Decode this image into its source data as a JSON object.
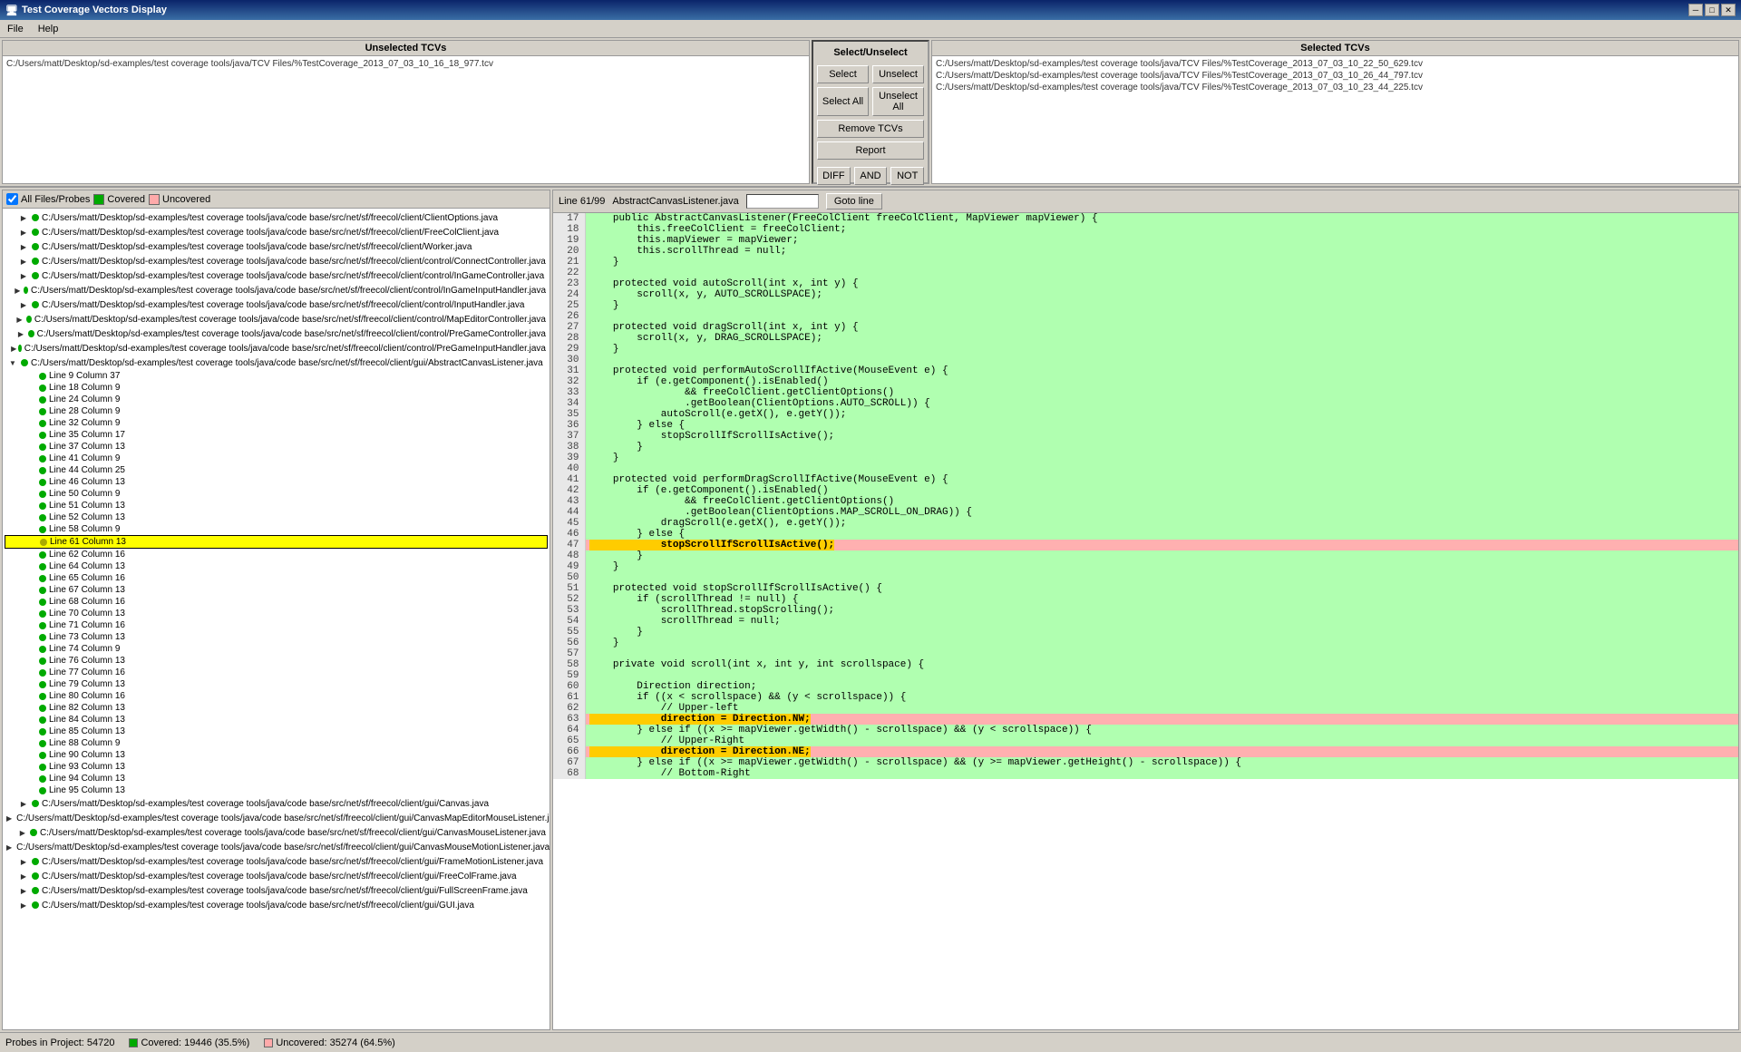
{
  "window": {
    "title": "Test Coverage Vectors Display",
    "menu": [
      "File",
      "Help"
    ]
  },
  "unselected_panel": {
    "header": "Unselected TCVs",
    "files": [
      "C:/Users/matt/Desktop/sd-examples/test coverage tools/java/TCV Files/%TestCoverage_2013_07_03_10_16_18_977.tcv"
    ]
  },
  "select_unselect": {
    "header": "Select/Unselect",
    "select": "Select",
    "unselect": "Unselect",
    "select_all": "Select All",
    "unselect_all": "Unselect All",
    "remove_tcvs": "Remove TCVs",
    "report": "Report",
    "diff": "DIFF",
    "and": "AND",
    "not": "NOT"
  },
  "selected_panel": {
    "header": "Selected TCVs",
    "files": [
      "C:/Users/matt/Desktop/sd-examples/test coverage tools/java/TCV Files/%TestCoverage_2013_07_03_10_22_50_629.tcv",
      "C:/Users/matt/Desktop/sd-examples/test coverage tools/java/TCV Files/%TestCoverage_2013_07_03_10_26_44_797.tcv",
      "C:/Users/matt/Desktop/sd-examples/test coverage tools/java/TCV Files/%TestCoverage_2013_07_03_10_23_44_225.tcv"
    ]
  },
  "filter": {
    "all_files": "All Files/Probes",
    "covered": "Covered",
    "uncovered": "Uncovered"
  },
  "code_header": {
    "line_info": "Line 61/99",
    "file": "AbstractCanvasListener.java",
    "goto_label": "Goto line"
  },
  "file_tree": {
    "items": [
      {
        "indent": 1,
        "type": "file",
        "dot": "green",
        "label": "C:/Users/matt/Desktop/sd-examples/test coverage tools/java/code base/src/net/sf/freecol/client/ClientOptions.java"
      },
      {
        "indent": 1,
        "type": "file",
        "dot": "green",
        "label": "C:/Users/matt/Desktop/sd-examples/test coverage tools/java/code base/src/net/sf/freecol/client/FreeColClient.java"
      },
      {
        "indent": 1,
        "type": "file",
        "dot": "green",
        "label": "C:/Users/matt/Desktop/sd-examples/test coverage tools/java/code base/src/net/sf/freecol/client/Worker.java"
      },
      {
        "indent": 1,
        "type": "file",
        "dot": "green",
        "label": "C:/Users/matt/Desktop/sd-examples/test coverage tools/java/code base/src/net/sf/freecol/client/control/ConnectController.java"
      },
      {
        "indent": 1,
        "type": "file",
        "dot": "green",
        "label": "C:/Users/matt/Desktop/sd-examples/test coverage tools/java/code base/src/net/sf/freecol/client/control/InGameController.java"
      },
      {
        "indent": 1,
        "type": "file",
        "dot": "green",
        "label": "C:/Users/matt/Desktop/sd-examples/test coverage tools/java/code base/src/net/sf/freecol/client/control/InGameInputHandler.java"
      },
      {
        "indent": 1,
        "type": "file",
        "dot": "green",
        "label": "C:/Users/matt/Desktop/sd-examples/test coverage tools/java/code base/src/net/sf/freecol/client/control/InputHandler.java"
      },
      {
        "indent": 1,
        "type": "file",
        "dot": "green",
        "label": "C:/Users/matt/Desktop/sd-examples/test coverage tools/java/code base/src/net/sf/freecol/client/control/MapEditorController.java"
      },
      {
        "indent": 1,
        "type": "file",
        "dot": "green",
        "label": "C:/Users/matt/Desktop/sd-examples/test coverage tools/java/code base/src/net/sf/freecol/client/control/PreGameController.java"
      },
      {
        "indent": 1,
        "type": "file",
        "dot": "green",
        "label": "C:/Users/matt/Desktop/sd-examples/test coverage tools/java/code base/src/net/sf/freecol/client/control/PreGameInputHandler.java"
      },
      {
        "indent": 0,
        "type": "folder",
        "dot": "green",
        "expanded": true,
        "label": "C:/Users/matt/Desktop/sd-examples/test coverage tools/java/code base/src/net/sf/freecol/client/gui/AbstractCanvasListener.java"
      },
      {
        "indent": 2,
        "type": "probe",
        "dot": "green",
        "label": "Line 9 Column 37"
      },
      {
        "indent": 2,
        "type": "probe",
        "dot": "green",
        "label": "Line 18 Column 9"
      },
      {
        "indent": 2,
        "type": "probe",
        "dot": "green",
        "label": "Line 24 Column 9"
      },
      {
        "indent": 2,
        "type": "probe",
        "dot": "green",
        "label": "Line 28 Column 9"
      },
      {
        "indent": 2,
        "type": "probe",
        "dot": "green",
        "label": "Line 32 Column 9"
      },
      {
        "indent": 2,
        "type": "probe",
        "dot": "green",
        "label": "Line 35 Column 17"
      },
      {
        "indent": 2,
        "type": "probe",
        "dot": "green",
        "label": "Line 37 Column 13"
      },
      {
        "indent": 2,
        "type": "probe",
        "dot": "green",
        "label": "Line 41 Column 9"
      },
      {
        "indent": 2,
        "type": "probe",
        "dot": "green",
        "label": "Line 44 Column 25"
      },
      {
        "indent": 2,
        "type": "probe",
        "dot": "green",
        "label": "Line 46 Column 13"
      },
      {
        "indent": 2,
        "type": "probe",
        "dot": "green",
        "label": "Line 50 Column 9"
      },
      {
        "indent": 2,
        "type": "probe",
        "dot": "green",
        "label": "Line 51 Column 13"
      },
      {
        "indent": 2,
        "type": "probe",
        "dot": "green",
        "label": "Line 52 Column 13"
      },
      {
        "indent": 2,
        "type": "probe",
        "dot": "green",
        "label": "Line 58 Column 9"
      },
      {
        "indent": 2,
        "type": "probe",
        "dot": "yellow",
        "label": "Line 61 Column 13",
        "selected": true
      },
      {
        "indent": 2,
        "type": "probe",
        "dot": "green",
        "label": "Line 62 Column 16"
      },
      {
        "indent": 2,
        "type": "probe",
        "dot": "green",
        "label": "Line 64 Column 13"
      },
      {
        "indent": 2,
        "type": "probe",
        "dot": "green",
        "label": "Line 65 Column 16"
      },
      {
        "indent": 2,
        "type": "probe",
        "dot": "green",
        "label": "Line 67 Column 13"
      },
      {
        "indent": 2,
        "type": "probe",
        "dot": "green",
        "label": "Line 68 Column 16"
      },
      {
        "indent": 2,
        "type": "probe",
        "dot": "green",
        "label": "Line 70 Column 13"
      },
      {
        "indent": 2,
        "type": "probe",
        "dot": "green",
        "label": "Line 71 Column 16"
      },
      {
        "indent": 2,
        "type": "probe",
        "dot": "green",
        "label": "Line 73 Column 13"
      },
      {
        "indent": 2,
        "type": "probe",
        "dot": "green",
        "label": "Line 74 Column 9"
      },
      {
        "indent": 2,
        "type": "probe",
        "dot": "green",
        "label": "Line 76 Column 13"
      },
      {
        "indent": 2,
        "type": "probe",
        "dot": "green",
        "label": "Line 77 Column 16"
      },
      {
        "indent": 2,
        "type": "probe",
        "dot": "green",
        "label": "Line 79 Column 13"
      },
      {
        "indent": 2,
        "type": "probe",
        "dot": "green",
        "label": "Line 80 Column 16"
      },
      {
        "indent": 2,
        "type": "probe",
        "dot": "green",
        "label": "Line 82 Column 13"
      },
      {
        "indent": 2,
        "type": "probe",
        "dot": "green",
        "label": "Line 84 Column 13"
      },
      {
        "indent": 2,
        "type": "probe",
        "dot": "green",
        "label": "Line 85 Column 13"
      },
      {
        "indent": 2,
        "type": "probe",
        "dot": "green",
        "label": "Line 88 Column 9"
      },
      {
        "indent": 2,
        "type": "probe",
        "dot": "green",
        "label": "Line 90 Column 13"
      },
      {
        "indent": 2,
        "type": "probe",
        "dot": "green",
        "label": "Line 93 Column 13"
      },
      {
        "indent": 2,
        "type": "probe",
        "dot": "green",
        "label": "Line 94 Column 13"
      },
      {
        "indent": 2,
        "type": "probe",
        "dot": "green",
        "label": "Line 95 Column 13"
      },
      {
        "indent": 1,
        "type": "file",
        "dot": "green",
        "label": "C:/Users/matt/Desktop/sd-examples/test coverage tools/java/code base/src/net/sf/freecol/client/gui/Canvas.java"
      },
      {
        "indent": 1,
        "type": "file",
        "dot": "green",
        "label": "C:/Users/matt/Desktop/sd-examples/test coverage tools/java/code base/src/net/sf/freecol/client/gui/CanvasMapEditorMouseListener.java"
      },
      {
        "indent": 1,
        "type": "file",
        "dot": "green",
        "label": "C:/Users/matt/Desktop/sd-examples/test coverage tools/java/code base/src/net/sf/freecol/client/gui/CanvasMouseListener.java"
      },
      {
        "indent": 1,
        "type": "file",
        "dot": "green",
        "label": "C:/Users/matt/Desktop/sd-examples/test coverage tools/java/code base/src/net/sf/freecol/client/gui/CanvasMouseMotionListener.java"
      },
      {
        "indent": 1,
        "type": "file",
        "dot": "green",
        "label": "C:/Users/matt/Desktop/sd-examples/test coverage tools/java/code base/src/net/sf/freecol/client/gui/FrameMotionListener.java"
      },
      {
        "indent": 1,
        "type": "file",
        "dot": "green",
        "label": "C:/Users/matt/Desktop/sd-examples/test coverage tools/java/code base/src/net/sf/freecol/client/gui/FreeColFrame.java"
      },
      {
        "indent": 1,
        "type": "file",
        "dot": "green",
        "label": "C:/Users/matt/Desktop/sd-examples/test coverage tools/java/code base/src/net/sf/freecol/client/gui/FullScreenFrame.java"
      },
      {
        "indent": 1,
        "type": "file",
        "dot": "green",
        "label": "C:/Users/matt/Desktop/sd-examples/test coverage tools/java/code base/src/net/sf/freecol/client/gui/GUI.java"
      }
    ]
  },
  "code": {
    "lines": [
      {
        "num": 17,
        "covered": true,
        "content": "    public AbstractCanvasListener(FreeColClient freeColClient, MapViewer mapViewer) {"
      },
      {
        "num": 18,
        "covered": true,
        "content": "        this.freeColClient = freeColClient;"
      },
      {
        "num": 19,
        "covered": true,
        "content": "        this.mapViewer = mapViewer;"
      },
      {
        "num": 20,
        "covered": true,
        "content": "        this.scrollThread = null;"
      },
      {
        "num": 21,
        "covered": true,
        "content": "    }"
      },
      {
        "num": 22,
        "covered": true,
        "content": ""
      },
      {
        "num": 23,
        "covered": true,
        "content": "    protected void autoScroll(int x, int y) {"
      },
      {
        "num": 24,
        "covered": true,
        "content": "        scroll(x, y, AUTO_SCROLLSPACE);"
      },
      {
        "num": 25,
        "covered": true,
        "content": "    }"
      },
      {
        "num": 26,
        "covered": true,
        "content": ""
      },
      {
        "num": 27,
        "covered": true,
        "content": "    protected void dragScroll(int x, int y) {"
      },
      {
        "num": 28,
        "covered": true,
        "content": "        scroll(x, y, DRAG_SCROLLSPACE);"
      },
      {
        "num": 29,
        "covered": true,
        "content": "    }"
      },
      {
        "num": 30,
        "covered": true,
        "content": ""
      },
      {
        "num": 31,
        "covered": true,
        "content": "    protected void performAutoScrollIfActive(MouseEvent e) {"
      },
      {
        "num": 32,
        "covered": true,
        "content": "        if (e.getComponent().isEnabled()"
      },
      {
        "num": 33,
        "covered": true,
        "content": "                && freeColClient.getClientOptions()"
      },
      {
        "num": 34,
        "covered": true,
        "content": "                .getBoolean(ClientOptions.AUTO_SCROLL)) {"
      },
      {
        "num": 35,
        "covered": true,
        "content": "            autoScroll(e.getX(), e.getY());"
      },
      {
        "num": 36,
        "covered": true,
        "content": "        } else {"
      },
      {
        "num": 37,
        "covered": true,
        "content": "            stopScrollIfScrollIsActive();"
      },
      {
        "num": 38,
        "covered": true,
        "content": "        }"
      },
      {
        "num": 39,
        "covered": true,
        "content": "    }"
      },
      {
        "num": 40,
        "covered": true,
        "content": ""
      },
      {
        "num": 41,
        "covered": true,
        "content": "    protected void performDragScrollIfActive(MouseEvent e) {"
      },
      {
        "num": 42,
        "covered": true,
        "content": "        if (e.getComponent().isEnabled()"
      },
      {
        "num": 43,
        "covered": true,
        "content": "                && freeColClient.getClientOptions()"
      },
      {
        "num": 44,
        "covered": true,
        "content": "                .getBoolean(ClientOptions.MAP_SCROLL_ON_DRAG)) {"
      },
      {
        "num": 45,
        "covered": true,
        "content": "            dragScroll(e.getX(), e.getY());"
      },
      {
        "num": 46,
        "covered": true,
        "content": "        } else {"
      },
      {
        "num": 47,
        "covered": false,
        "highlight": true,
        "content": "            stopScrollIfScrollIsActive();"
      },
      {
        "num": 48,
        "covered": true,
        "content": "        }"
      },
      {
        "num": 49,
        "covered": true,
        "content": "    }"
      },
      {
        "num": 50,
        "covered": true,
        "content": ""
      },
      {
        "num": 51,
        "covered": true,
        "content": "    protected void stopScrollIfScrollIsActive() {"
      },
      {
        "num": 52,
        "covered": true,
        "content": "        if (scrollThread != null) {"
      },
      {
        "num": 53,
        "covered": true,
        "content": "            scrollThread.stopScrolling();"
      },
      {
        "num": 54,
        "covered": true,
        "content": "            scrollThread = null;"
      },
      {
        "num": 55,
        "covered": true,
        "content": "        }"
      },
      {
        "num": 56,
        "covered": true,
        "content": "    }"
      },
      {
        "num": 57,
        "covered": true,
        "content": ""
      },
      {
        "num": 58,
        "covered": true,
        "content": "    private void scroll(int x, int y, int scrollspace) {"
      },
      {
        "num": 59,
        "covered": true,
        "content": ""
      },
      {
        "num": 60,
        "covered": true,
        "content": "        Direction direction;"
      },
      {
        "num": 61,
        "covered": true,
        "content": "        if ((x < scrollspace) && (y < scrollspace)) {"
      },
      {
        "num": 62,
        "covered": true,
        "content": "            // Upper-left"
      },
      {
        "num": 63,
        "covered": false,
        "highlight": true,
        "content": "            direction = Direction.NW;"
      },
      {
        "num": 64,
        "covered": true,
        "content": "        } else if ((x >= mapViewer.getWidth() - scrollspace) && (y < scrollspace)) {"
      },
      {
        "num": 65,
        "covered": true,
        "content": "            // Upper-Right"
      },
      {
        "num": 66,
        "covered": false,
        "highlight": true,
        "content": "            direction = Direction.NE;"
      },
      {
        "num": 67,
        "covered": true,
        "content": "        } else if ((x >= mapViewer.getWidth() - scrollspace) && (y >= mapViewer.getHeight() - scrollspace)) {"
      },
      {
        "num": 68,
        "covered": true,
        "content": "            // Bottom-Right"
      }
    ]
  },
  "status_bar": {
    "probes_label": "Probes in Project: 54720",
    "covered_label": "Covered: 19446 (35.5%)",
    "uncovered_label": "Uncovered: 35274 (64.5%)"
  }
}
